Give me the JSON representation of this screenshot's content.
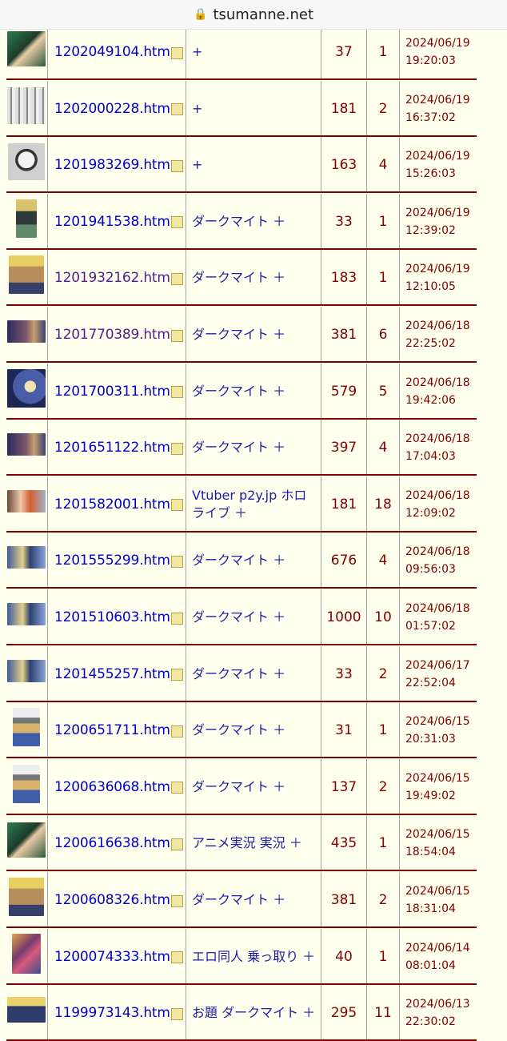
{
  "browser": {
    "host": "tsumanne.net"
  },
  "rows": [
    {
      "file": "1202049104.htm",
      "tags": "+",
      "res": "37",
      "imgs": "1",
      "date": "2024/06/19",
      "time": "19:20:03",
      "visited": false,
      "thumb": "green-character"
    },
    {
      "file": "1202000228.htm",
      "tags": "+",
      "res": "181",
      "imgs": "2",
      "date": "2024/06/19",
      "time": "16:37:02",
      "visited": false,
      "thumb": "manga-page"
    },
    {
      "file": "1201983269.htm",
      "tags": "+",
      "res": "163",
      "imgs": "4",
      "date": "2024/06/19",
      "time": "15:26:03",
      "visited": false,
      "thumb": "manga-face"
    },
    {
      "file": "1201941538.htm",
      "tags": "ダークマイト ＋",
      "res": "33",
      "imgs": "1",
      "date": "2024/06/19",
      "time": "12:39:02",
      "visited": false,
      "thumb": "blond-figure-small"
    },
    {
      "file": "1201932162.htm",
      "tags": "ダークマイト ＋",
      "res": "183",
      "imgs": "1",
      "date": "2024/06/19",
      "time": "12:10:05",
      "visited": true,
      "thumb": "blond-face"
    },
    {
      "file": "1201770389.htm",
      "tags": "ダークマイト ＋",
      "res": "381",
      "imgs": "6",
      "date": "2024/06/18",
      "time": "22:25:02",
      "visited": true,
      "thumb": "dark-scene"
    },
    {
      "file": "1201700311.htm",
      "tags": "ダークマイト ＋",
      "res": "579",
      "imgs": "5",
      "date": "2024/06/18",
      "time": "19:42:06",
      "visited": false,
      "thumb": "blue-villain"
    },
    {
      "file": "1201651122.htm",
      "tags": "ダークマイト ＋",
      "res": "397",
      "imgs": "4",
      "date": "2024/06/18",
      "time": "17:04:03",
      "visited": false,
      "thumb": "dark-scene"
    },
    {
      "file": "1201582001.htm",
      "tags": "Vtuber p2y.jp ホロライブ ＋",
      "res": "181",
      "imgs": "18",
      "date": "2024/06/18",
      "time": "12:09:02",
      "visited": false,
      "thumb": "vtuber"
    },
    {
      "file": "1201555299.htm",
      "tags": "ダークマイト ＋",
      "res": "676",
      "imgs": "4",
      "date": "2024/06/18",
      "time": "09:56:03",
      "visited": false,
      "thumb": "anime-wide"
    },
    {
      "file": "1201510603.htm",
      "tags": "ダークマイト ＋",
      "res": "1000",
      "imgs": "10",
      "date": "2024/06/18",
      "time": "01:57:02",
      "visited": false,
      "thumb": "anime-wide"
    },
    {
      "file": "1201455257.htm",
      "tags": "ダークマイト ＋",
      "res": "33",
      "imgs": "2",
      "date": "2024/06/17",
      "time": "22:52:04",
      "visited": false,
      "thumb": "anime-wide"
    },
    {
      "file": "1200651711.htm",
      "tags": "ダークマイト ＋",
      "res": "31",
      "imgs": "1",
      "date": "2024/06/15",
      "time": "20:31:03",
      "visited": false,
      "thumb": "manga-tall"
    },
    {
      "file": "1200636068.htm",
      "tags": "ダークマイト ＋",
      "res": "137",
      "imgs": "2",
      "date": "2024/06/15",
      "time": "19:49:02",
      "visited": false,
      "thumb": "manga-tall"
    },
    {
      "file": "1200616638.htm",
      "tags": "アニメ実況 実況 ＋",
      "res": "435",
      "imgs": "1",
      "date": "2024/06/15",
      "time": "18:54:04",
      "visited": false,
      "thumb": "green-character"
    },
    {
      "file": "1200608326.htm",
      "tags": "ダークマイト ＋",
      "res": "381",
      "imgs": "2",
      "date": "2024/06/15",
      "time": "18:31:04",
      "visited": false,
      "thumb": "blond-face"
    },
    {
      "file": "1200074333.htm",
      "tags": "エロ同人 乗っ取り ＋",
      "res": "40",
      "imgs": "1",
      "date": "2024/06/14",
      "time": "08:01:04",
      "visited": false,
      "thumb": "cover-art"
    },
    {
      "file": "1199973143.htm",
      "tags": "お題 ダークマイト ＋",
      "res": "295",
      "imgs": "11",
      "date": "2024/06/13",
      "time": "22:30:02",
      "visited": false,
      "thumb": "blond-figure"
    }
  ],
  "colors": {
    "link": "#0000c8",
    "visited": "#551a8b",
    "accent": "#800000",
    "background": "#ffffee"
  }
}
